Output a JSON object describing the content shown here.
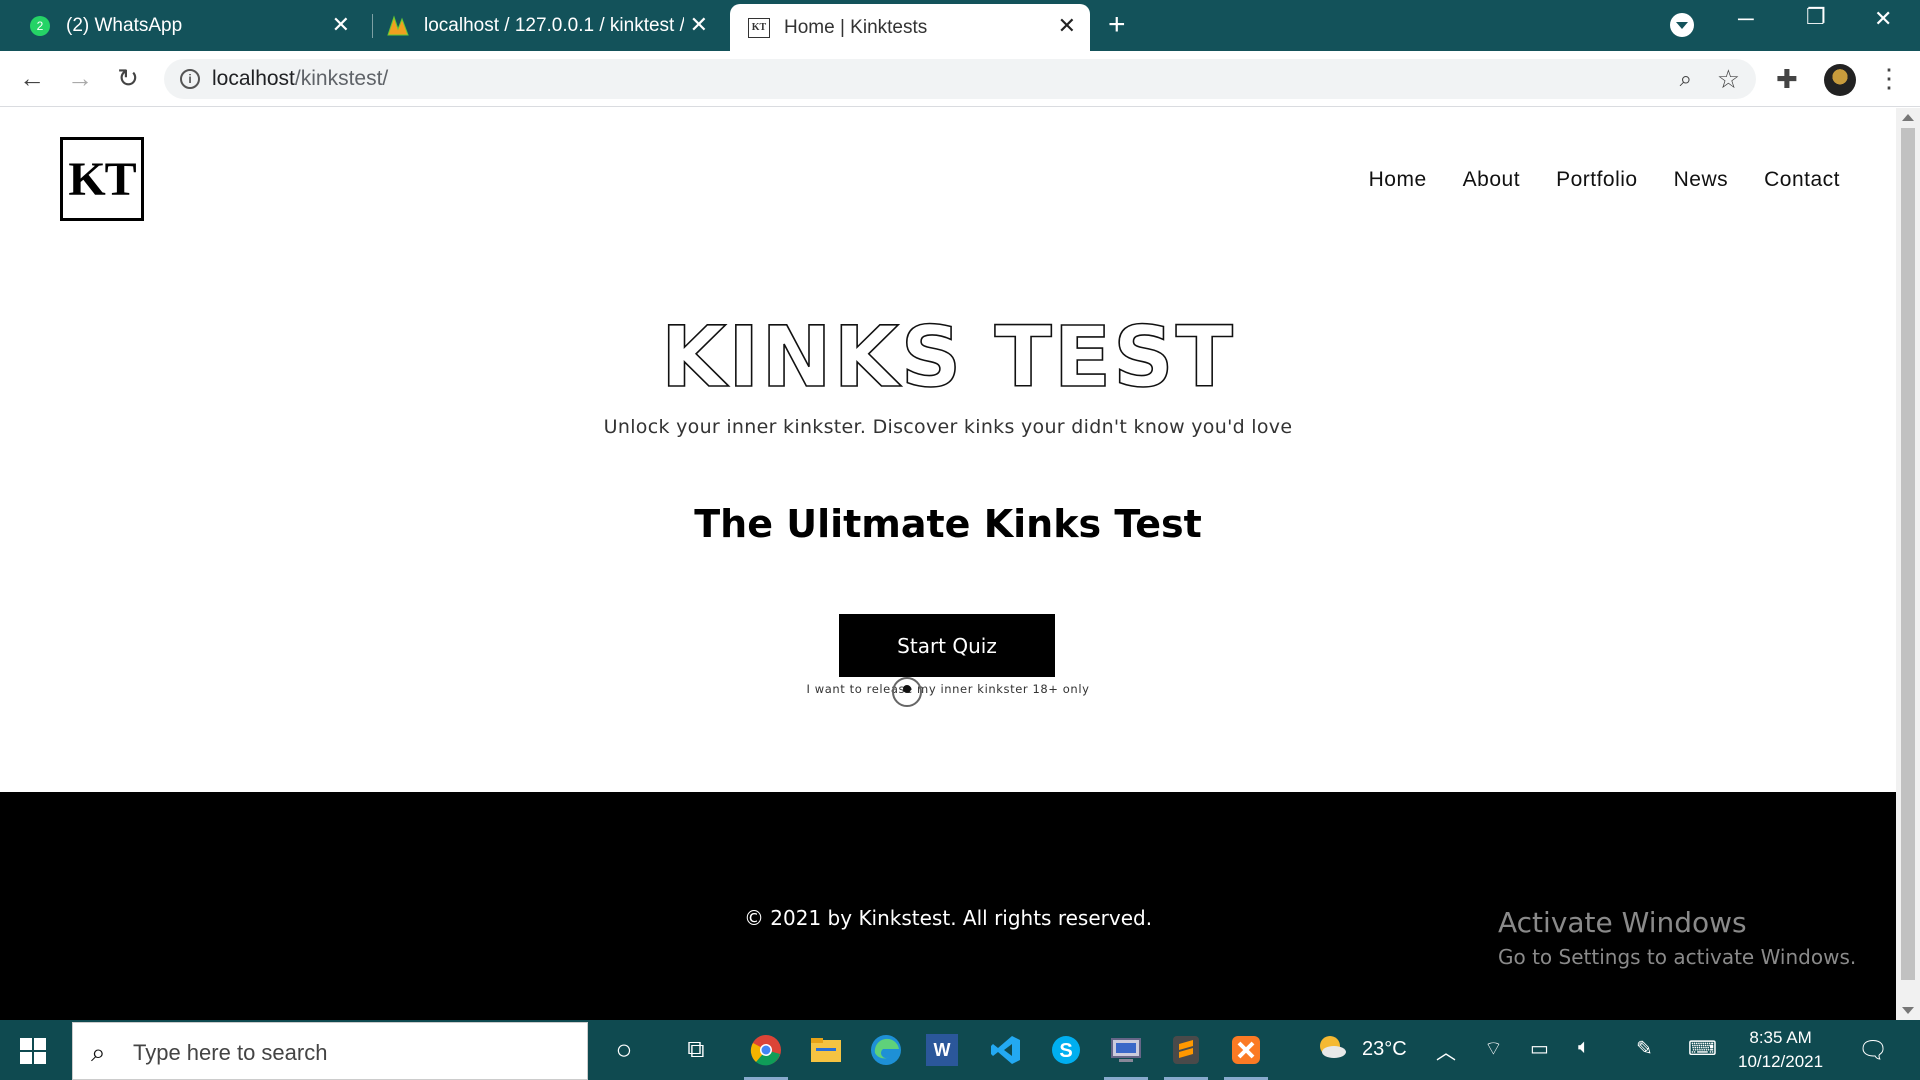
{
  "browser": {
    "tabs": [
      {
        "title": "(2) WhatsApp",
        "icon": "whatsapp-icon",
        "badge": "2"
      },
      {
        "title": "localhost / 127.0.0.1 / kinktest / c",
        "icon": "phpmyadmin-icon"
      },
      {
        "title": "Home | Kinktests",
        "icon": "kt-favicon",
        "favicon_text": "KT",
        "active": true
      }
    ],
    "url_host": "localhost",
    "url_path": "/kinkstest/"
  },
  "page": {
    "logo_text": "KT",
    "nav": [
      "Home",
      "About",
      "Portfolio",
      "News",
      "Contact"
    ],
    "hero_title": "KINKS TEST",
    "tagline": "Unlock your inner kinkster. Discover kinks your didn't know you'd love",
    "subhead": "The Ulitmate Kinks Test",
    "start_button": "Start Quiz",
    "disclaimer": "I want to release my inner kinkster 18+ only",
    "footer_copyright": "© 2021 by Kinkstest. All rights reserved."
  },
  "watermark": {
    "line1": "Activate Windows",
    "line2": "Go to Settings to activate Windows."
  },
  "taskbar": {
    "search_placeholder": "Type here to search",
    "weather_temp": "23°C",
    "time": "8:35 AM",
    "date": "10/12/2021"
  },
  "colors": {
    "chrome_frame": "#13525a",
    "taskbar": "#0f4a50",
    "button_bg": "#000000",
    "footer_bg": "#000000"
  }
}
